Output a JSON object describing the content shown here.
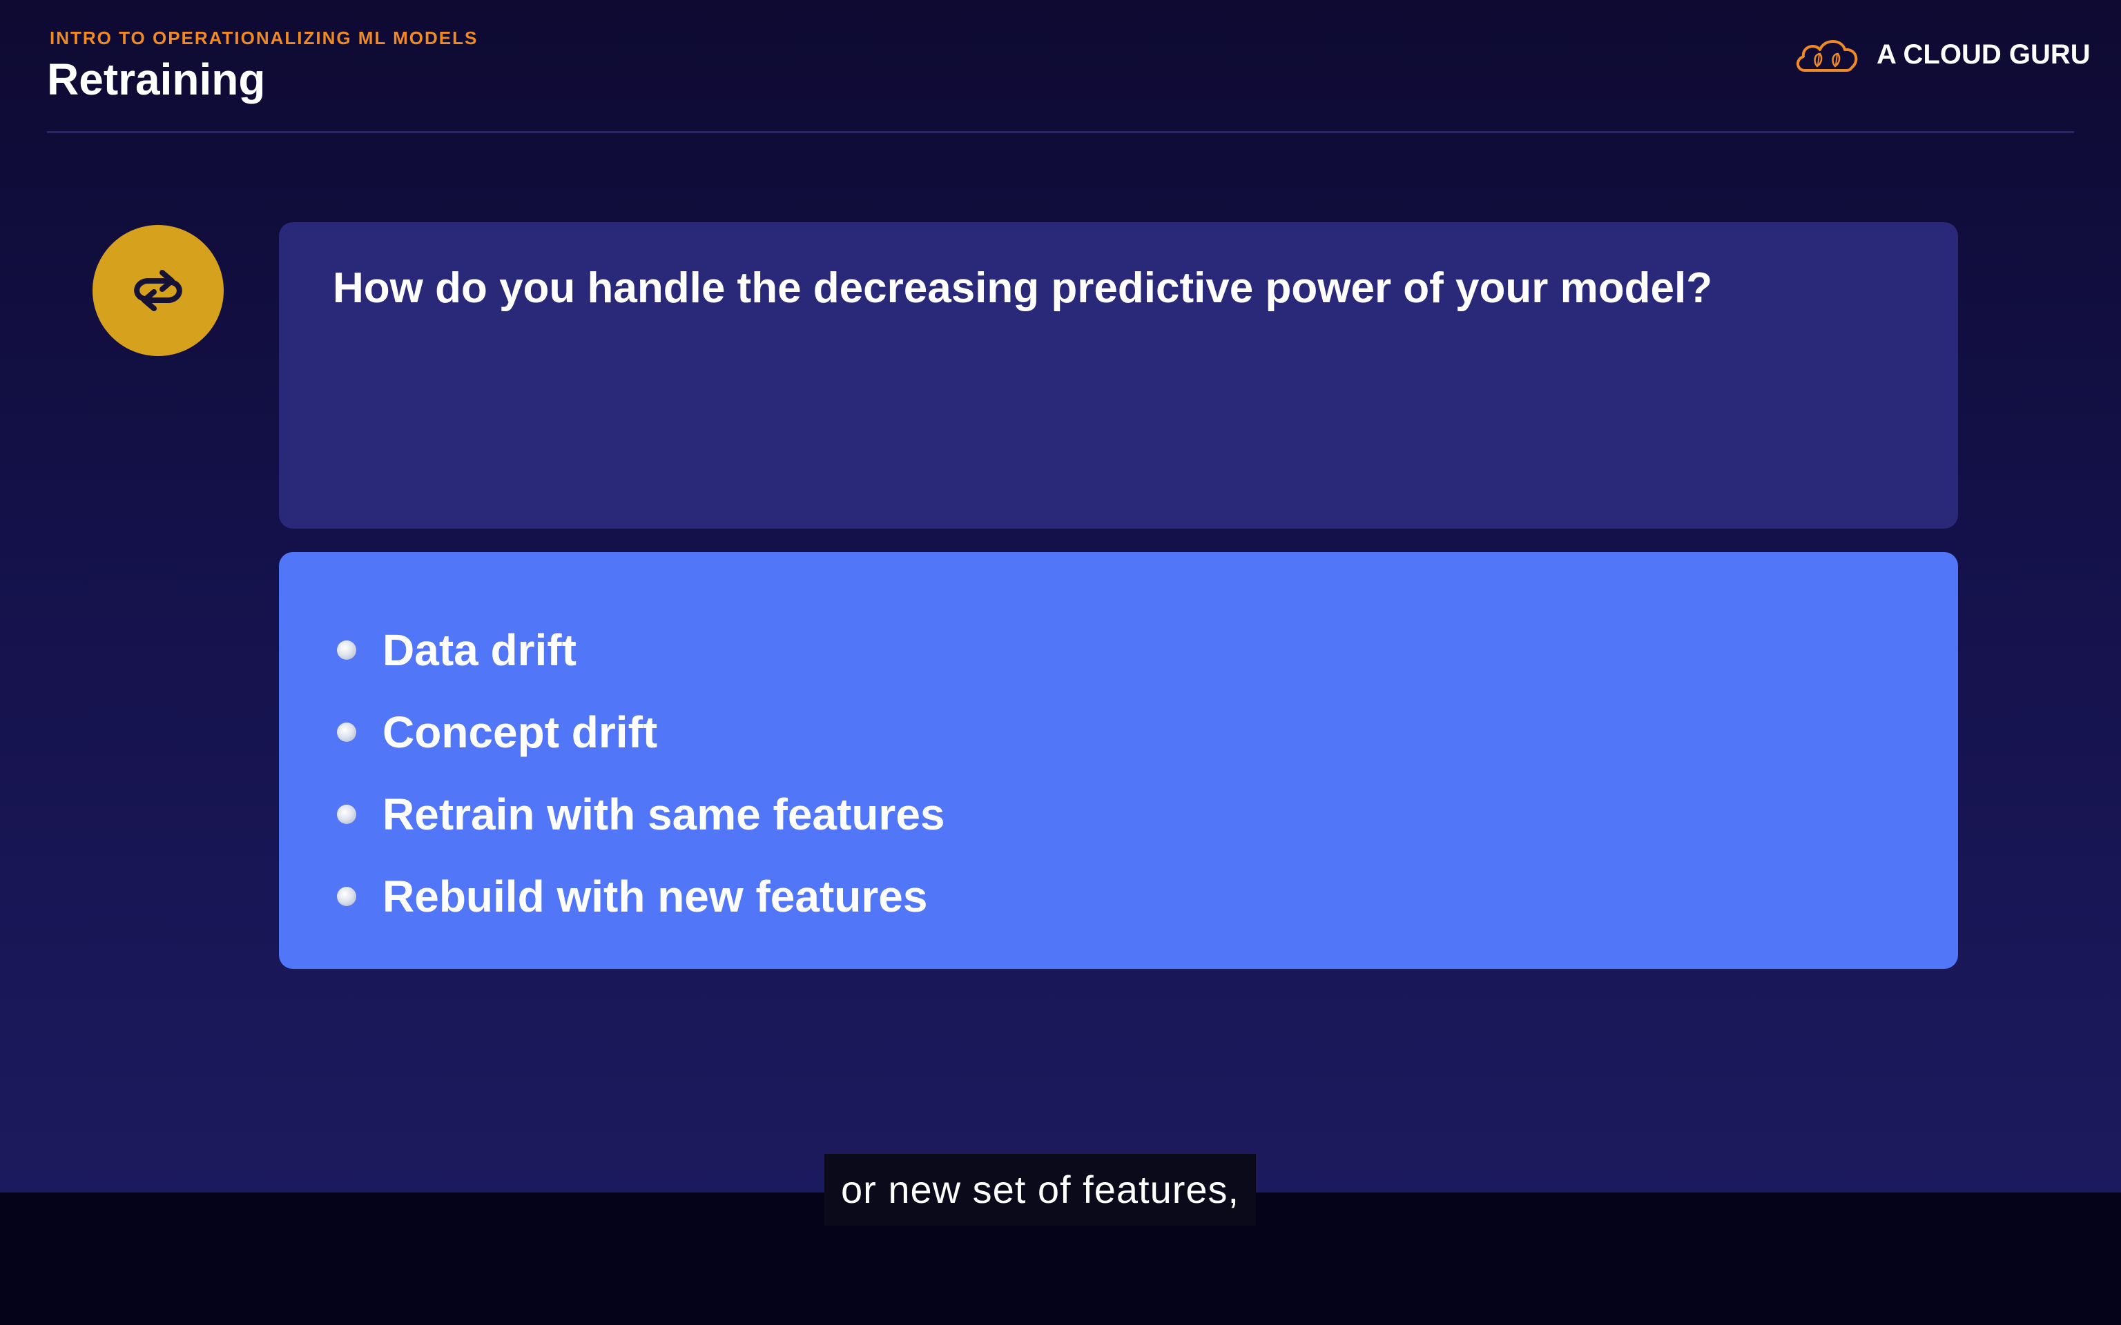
{
  "header": {
    "course_label": "INTRO TO OPERATIONALIZING ML MODELS",
    "title": "Retraining"
  },
  "logo": {
    "text": "A CLOUD GURU",
    "icon": "cloud-guru-logo-icon",
    "color": "#f08a24"
  },
  "badge": {
    "icon": "retrain-cycle-icon",
    "color": "#d6a21e"
  },
  "question": {
    "text": "How do you handle the decreasing predictive power of your model?"
  },
  "answers": {
    "items": [
      "Data drift",
      "Concept drift",
      "Retrain with same features",
      "Rebuild with new features"
    ]
  },
  "caption": {
    "text": "or new set of features,"
  },
  "colors": {
    "accent_orange": "#f08a24",
    "badge_gold": "#d6a21e",
    "question_card": "#2a2878",
    "answer_card": "#5176f7",
    "background": "#14114a"
  }
}
